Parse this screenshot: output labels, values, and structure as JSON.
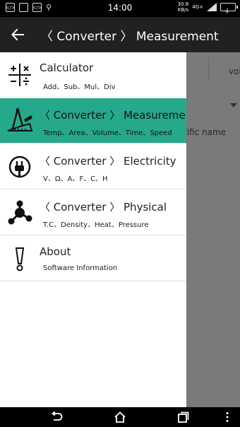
{
  "status_bar": {
    "time": "14:00",
    "speed_value": "30.8",
    "speed_unit": "KB/s",
    "network": "4G+",
    "icons": [
      "code-icon",
      "square-icon",
      "code-icon",
      "usb-icon",
      "signal-icon",
      "battery-icon"
    ]
  },
  "app_bar": {
    "title": "〈 Converter 〉 Measurement",
    "back_icon": "arrow-left-icon"
  },
  "background": {
    "tab_text": "vol",
    "field_text": "tific name"
  },
  "drawer": {
    "items": [
      {
        "title": "Calculator",
        "subtitle": "Add、Sub、Mul、Div",
        "icon": "calculator-icon",
        "active": false
      },
      {
        "title": "〈 Converter 〉 Measurement",
        "subtitle": "Temp、Area、Volume、Time、Speed",
        "icon": "measurement-tools-icon",
        "active": true
      },
      {
        "title": "〈 Converter 〉 Electricity",
        "subtitle": "V、Ω、A、F、C、H",
        "icon": "electricity-plug-icon",
        "active": false
      },
      {
        "title": "〈 Converter 〉 Physical",
        "subtitle": "T.C、Density、Heat、Pressure",
        "icon": "molecule-icon",
        "active": false
      },
      {
        "title": "About",
        "subtitle": "Software Information",
        "icon": "exclamation-icon",
        "active": false
      }
    ]
  },
  "colors": {
    "accent": "#26a98b",
    "app_bar": "#212121",
    "scrim": "#7a7a7a"
  },
  "nav_bar": {
    "icons": [
      "back-icon",
      "home-icon",
      "recents-icon",
      "menu-icon"
    ]
  }
}
